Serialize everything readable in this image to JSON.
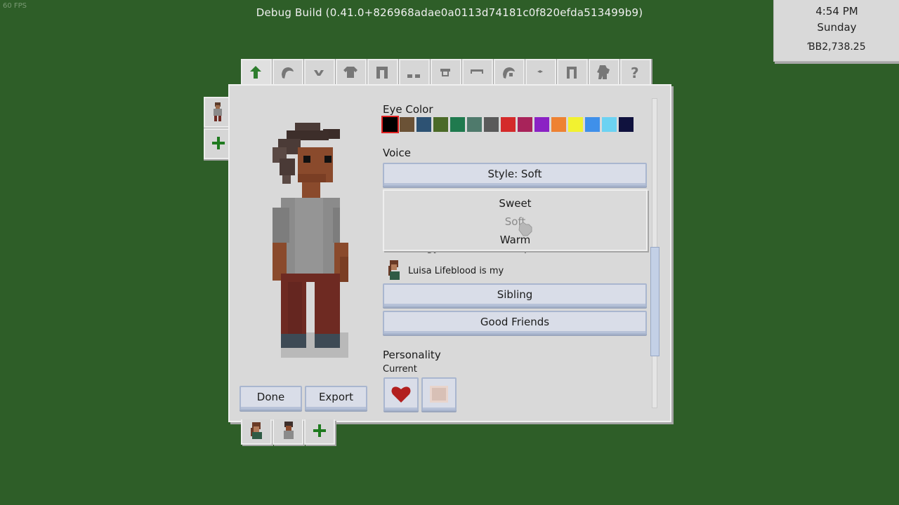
{
  "fps": "60 FPS",
  "debug_build": "Debug Build (0.41.0+826968adae0a0113d74181c0f820efda513499b9)",
  "clock": {
    "time": "4:54 PM",
    "day": "Sunday",
    "money": "ƁB2,738.25"
  },
  "tabs": [
    {
      "name": "tab-body",
      "icon": "body-arrow-icon"
    },
    {
      "name": "tab-hair",
      "icon": "hair-icon"
    },
    {
      "name": "tab-eyes",
      "icon": "eyes-icon"
    },
    {
      "name": "tab-shirt",
      "icon": "shirt-icon"
    },
    {
      "name": "tab-pants",
      "icon": "pants-icon"
    },
    {
      "name": "tab-shoes",
      "icon": "shoes-icon"
    },
    {
      "name": "tab-accessory",
      "icon": "accessory-icon"
    },
    {
      "name": "tab-glasses",
      "icon": "glasses-icon"
    },
    {
      "name": "tab-hat",
      "icon": "hat-icon"
    },
    {
      "name": "tab-ears",
      "icon": "ears-icon"
    },
    {
      "name": "tab-outfit",
      "icon": "outfit-icon"
    },
    {
      "name": "tab-full-body",
      "icon": "full-body-icon"
    },
    {
      "name": "tab-help",
      "icon": "question-icon"
    }
  ],
  "eye_color": {
    "label": "Eye Color",
    "colors": [
      "#000000",
      "#6b5236",
      "#2d5273",
      "#4b6a28",
      "#1f7a4e",
      "#4f7a6c",
      "#5a5a5a",
      "#d42a2a",
      "#a8235a",
      "#8b22c4",
      "#ee8232",
      "#f2f230",
      "#3f90ea",
      "#6cd2f2",
      "#10123e"
    ],
    "selected_index": 0,
    "selected_border": "#e02222"
  },
  "voice": {
    "label": "Voice",
    "style_button": "Style: Soft",
    "options": [
      "Sweet",
      "Soft",
      "Warm"
    ],
    "selected_option": "Soft"
  },
  "genealogy": {
    "label": "Genealogy and Relationships",
    "relation_text": "Luisa Lifeblood is my",
    "relation_button": "Sibling",
    "friendship_button": "Good Friends"
  },
  "personality": {
    "label": "Personality",
    "sub_label": "Current",
    "traits": [
      {
        "icon": "heart-icon"
      },
      {
        "icon": "scroll-icon"
      }
    ]
  },
  "buttons": {
    "done": "Done",
    "export": "Export"
  },
  "side_tabs": [
    {
      "icon": "character-portrait-icon"
    },
    {
      "icon": "plus-icon"
    }
  ],
  "bottom_tabs": [
    {
      "icon": "luisa-portrait-icon"
    },
    {
      "icon": "character-portrait-icon"
    },
    {
      "icon": "plus-icon"
    }
  ],
  "colors": {
    "background": "#2e5e28",
    "button": "#d9dde8",
    "plus": "#1f7a1f"
  }
}
